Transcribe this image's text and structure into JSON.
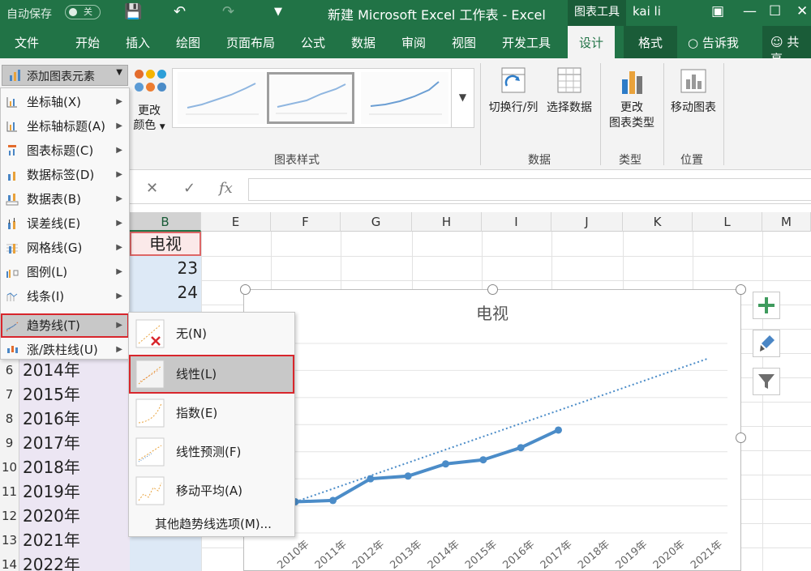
{
  "titlebar": {
    "autosave_label": "自动保存",
    "autosave_state": "关",
    "window_title": "新建 Microsoft Excel 工作表 - Excel",
    "context_tools": "图表工具",
    "user": "kai li"
  },
  "tabs": [
    "文件",
    "开始",
    "插入",
    "绘图",
    "页面布局",
    "公式",
    "数据",
    "审阅",
    "视图",
    "开发工具",
    "设计",
    "格式"
  ],
  "tell_me": "告诉我",
  "share": "共享",
  "ribbon": {
    "add_element": "添加图表元素",
    "change_colors_1": "更改",
    "change_colors_2": "颜色",
    "chart_styles_group": "图表样式",
    "switch_row_col": "切换行/列",
    "select_data": "选择数据",
    "data_group": "数据",
    "change_type_1": "更改",
    "change_type_2": "图表类型",
    "type_group": "类型",
    "move_chart": "移动图表",
    "location_group": "位置",
    "accent": "#217346"
  },
  "formula": {
    "cancel": "✕",
    "enter": "✓",
    "fx": "fx"
  },
  "columns": [
    "B",
    "E",
    "F",
    "G",
    "H",
    "I",
    "J",
    "K",
    "L",
    "M"
  ],
  "sheet": {
    "b_header": "电视",
    "b_values": [
      "23",
      "24"
    ],
    "rows": [
      {
        "n": "6",
        "v": "2014年"
      },
      {
        "n": "7",
        "v": "2015年"
      },
      {
        "n": "8",
        "v": "2016年"
      },
      {
        "n": "9",
        "v": "2017年"
      },
      {
        "n": "10",
        "v": "2018年"
      },
      {
        "n": "11",
        "v": "2019年"
      },
      {
        "n": "12",
        "v": "2020年"
      },
      {
        "n": "13",
        "v": "2021年"
      },
      {
        "n": "14",
        "v": "2022年"
      }
    ]
  },
  "menu": {
    "items": [
      "坐标轴(X)",
      "坐标轴标题(A)",
      "图表标题(C)",
      "数据标签(D)",
      "数据表(B)",
      "误差线(E)",
      "网格线(G)",
      "图例(L)",
      "线条(I)",
      "趋势线(T)",
      "涨/跌柱线(U)"
    ],
    "trendline": [
      "无(N)",
      "线性(L)",
      "指数(E)",
      "线性预测(F)",
      "移动平均(A)"
    ],
    "trendline_more": "其他趋势线选项(M)..."
  },
  "chart_data": {
    "type": "line",
    "title": "电视",
    "categories": [
      "2010年",
      "2011年",
      "2012年",
      "2013年",
      "2014年",
      "2015年",
      "2016年",
      "2017年",
      "2018年",
      "2019年",
      "2020年",
      "2021年"
    ],
    "series": [
      {
        "values": [
          23,
          24,
          40,
          42,
          51,
          54,
          63,
          76
        ],
        "color": "#4b8cc8"
      }
    ],
    "trendline": {
      "type": "linear",
      "from": 23,
      "to": 129,
      "extends_to_index": 11,
      "color": "#4b8cc8",
      "style": "dotted"
    },
    "ylim": [
      0,
      140
    ],
    "grid": true
  }
}
